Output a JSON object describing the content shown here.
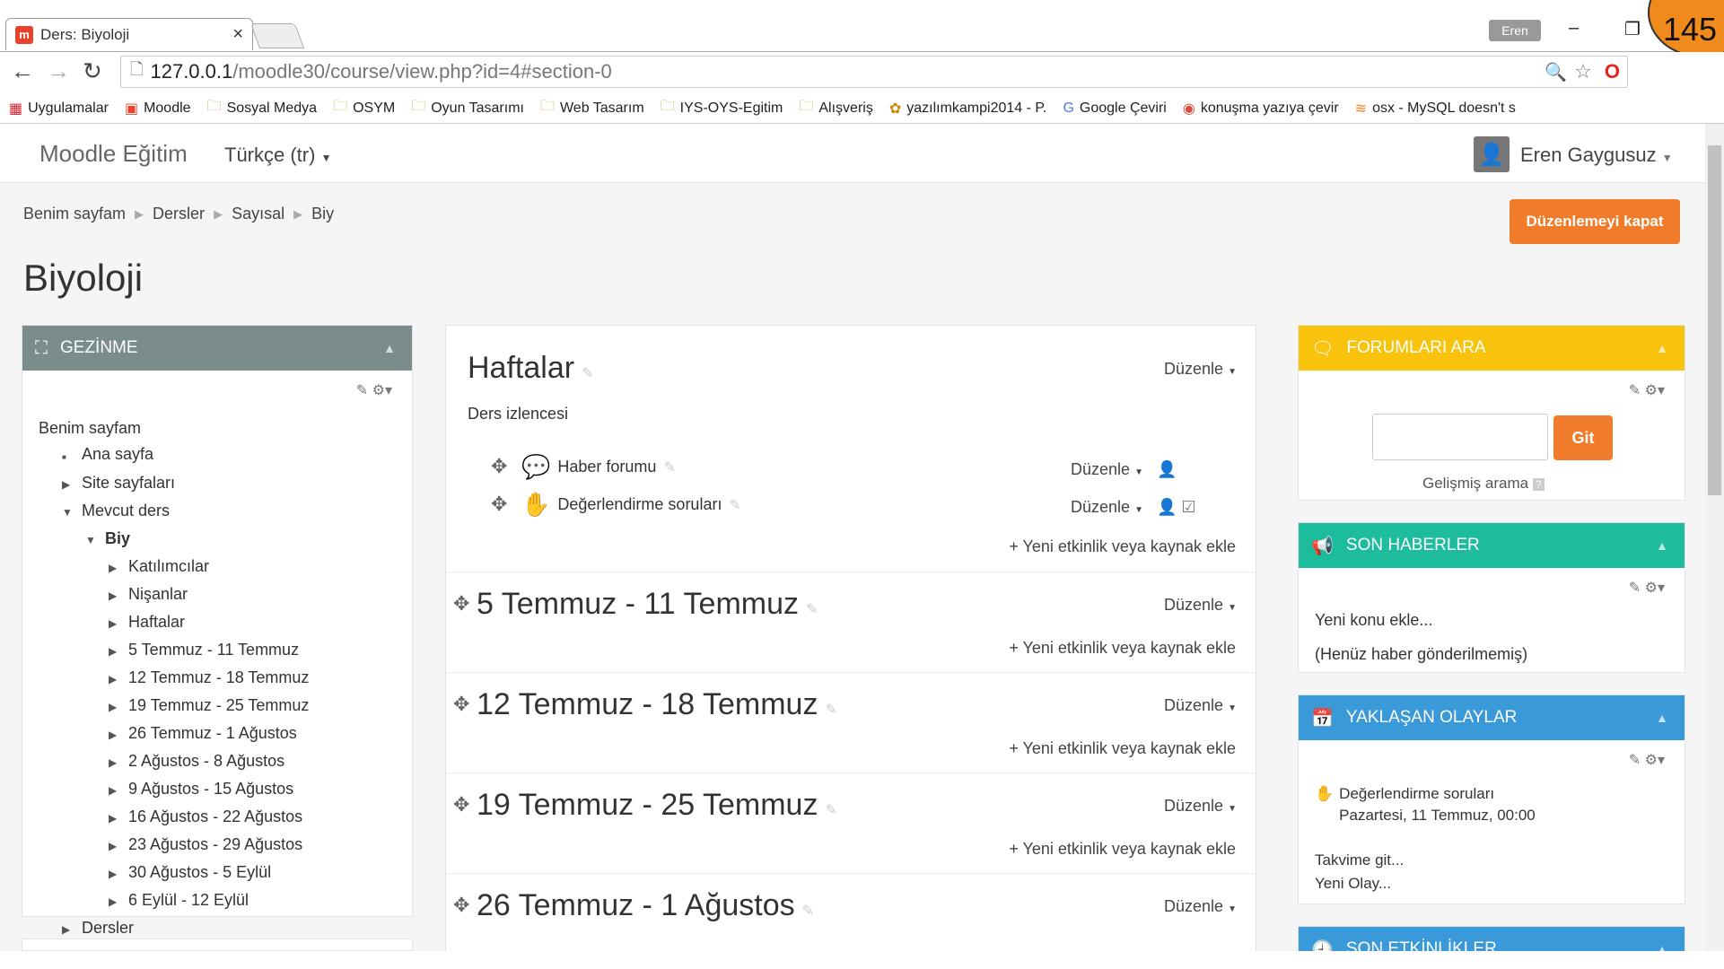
{
  "browser": {
    "tab_title": "Ders: Biyoloji",
    "user_badge": "Eren",
    "notification_count": "145",
    "url_host": "127.0.0.1",
    "url_path": "/moodle30/course/view.php?id=4#section-0",
    "bookmarks": [
      "Uygulamalar",
      "Moodle",
      "Sosyal Medya",
      "OSYM",
      "Oyun Tasarımı",
      "Web Tasarım",
      "IYS-OYS-Egitim",
      "Alışveriş",
      "yazılımkampi2014 - P.",
      "Google Çeviri",
      "konuşma yazıya çevir",
      "osx - MySQL doesn't s"
    ]
  },
  "navbar": {
    "brand": "Moodle Eğitim",
    "language": "Türkçe (tr)",
    "user_name": "Eren Gaygusuz"
  },
  "breadcrumb": [
    "Benim sayfam",
    "Dersler",
    "Sayısal",
    "Biy"
  ],
  "edit_button": "Düzenlemeyi kapat",
  "page_title": "Biyoloji",
  "nav_block": {
    "title": "GEZİNME",
    "items": [
      {
        "label": "Benim sayfam",
        "indent": 0,
        "marker": ""
      },
      {
        "label": "Ana sayfa",
        "indent": 1,
        "marker": "■"
      },
      {
        "label": "Site sayfaları",
        "indent": 1,
        "marker": "▶"
      },
      {
        "label": "Mevcut ders",
        "indent": 1,
        "marker": "▼"
      },
      {
        "label": "Biy",
        "indent": 2,
        "marker": "▼"
      },
      {
        "label": "Katılımcılar",
        "indent": 3,
        "marker": "▶"
      },
      {
        "label": "Nişanlar",
        "indent": 3,
        "marker": "▶"
      },
      {
        "label": "Haftalar",
        "indent": 3,
        "marker": "▶"
      },
      {
        "label": "5 Temmuz - 11 Temmuz",
        "indent": 3,
        "marker": "▶"
      },
      {
        "label": "12 Temmuz - 18 Temmuz",
        "indent": 3,
        "marker": "▶"
      },
      {
        "label": "19 Temmuz - 25 Temmuz",
        "indent": 3,
        "marker": "▶"
      },
      {
        "label": "26 Temmuz - 1 Ağustos",
        "indent": 3,
        "marker": "▶"
      },
      {
        "label": "2 Ağustos - 8 Ağustos",
        "indent": 3,
        "marker": "▶"
      },
      {
        "label": "9 Ağustos - 15 Ağustos",
        "indent": 3,
        "marker": "▶"
      },
      {
        "label": "16 Ağustos - 22 Ağustos",
        "indent": 3,
        "marker": "▶"
      },
      {
        "label": "23 Ağustos - 29 Ağustos",
        "indent": 3,
        "marker": "▶"
      },
      {
        "label": "30 Ağustos - 5 Eylül",
        "indent": 3,
        "marker": "▶"
      },
      {
        "label": "6 Eylül - 12 Eylül",
        "indent": 3,
        "marker": "▶"
      },
      {
        "label": "Dersler",
        "indent": 1,
        "marker": "▶"
      }
    ]
  },
  "course": {
    "section0": {
      "title": "Haftalar",
      "summary": "Ders izlencesi",
      "activities": [
        "Haber forumu",
        "Değerlendirme soruları"
      ]
    },
    "edit_label": "Düzenle",
    "add_label": "Yeni etkinlik veya kaynak ekle",
    "weeks": [
      "5 Temmuz - 11 Temmuz",
      "12 Temmuz - 18 Temmuz",
      "19 Temmuz - 25 Temmuz",
      "26 Temmuz - 1 Ağustos"
    ]
  },
  "search_block": {
    "title": "FORUMLARI ARA",
    "button": "Git",
    "advanced": "Gelişmiş arama",
    "color": "#f9c20c"
  },
  "news_block": {
    "title": "SON HABERLER",
    "add_topic": "Yeni konu ekle...",
    "empty": "(Henüz haber gönderilmemiş)",
    "color": "#1dbc9c"
  },
  "events_block": {
    "title": "YAKLAŞAN OLAYLAR",
    "event_name": "Değerlendirme soruları",
    "event_date": "Pazartesi, 11 Temmuz, 00:00",
    "calendar_link": "Takvime git...",
    "new_event": "Yeni Olay...",
    "color": "#3a9ad9"
  },
  "recent_block": {
    "title": "SON ETKİNLİKLER",
    "color": "#3a9ad9"
  },
  "nav_block_color": "#7a8c8c"
}
